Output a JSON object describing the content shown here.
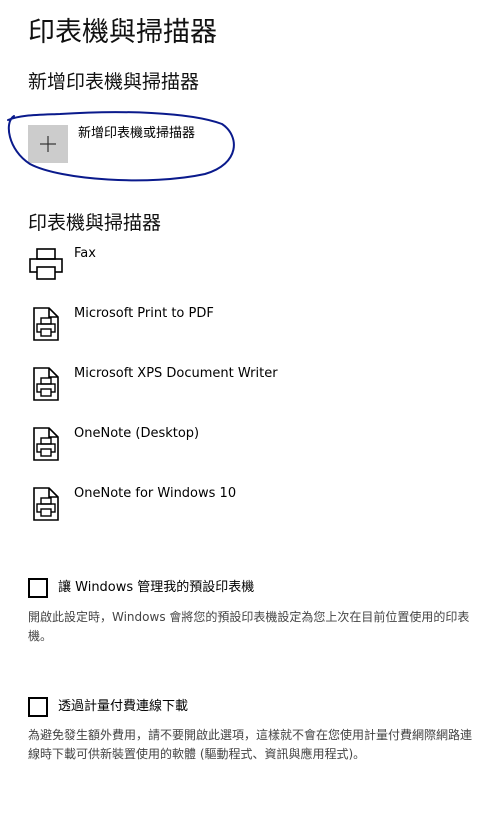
{
  "page": {
    "title": "印表機與掃描器"
  },
  "add_section": {
    "heading": "新增印表機與掃描器",
    "add_button_label": "新增印表機或掃描器",
    "add_icon": "plus-icon"
  },
  "printers_section": {
    "heading": "印表機與掃描器",
    "items": [
      {
        "name": "Fax",
        "icon": "fax-printer-icon"
      },
      {
        "name": "Microsoft Print to PDF",
        "icon": "printer-icon"
      },
      {
        "name": "Microsoft XPS Document Writer",
        "icon": "printer-icon"
      },
      {
        "name": "OneNote (Desktop)",
        "icon": "printer-icon"
      },
      {
        "name": "OneNote for Windows 10",
        "icon": "printer-icon"
      }
    ]
  },
  "options": [
    {
      "label": "讓 Windows 管理我的預設印表機",
      "checked": false,
      "description": "開啟此設定時，Windows 會將您的預設印表機設定為您上次在目前位置使用的印表機。"
    },
    {
      "label": "透過計量付費連線下載",
      "checked": false,
      "description": "為避免發生額外費用，請不要開啟此選項，這樣就不會在您使用計量付費網際網路連線時下載可供新裝置使用的軟體 (驅動程式、資訊與應用程式)。"
    }
  ],
  "colors": {
    "tile_bg": "#cccccc",
    "annotation_ink": "#0a1a8c",
    "description_text": "#444444"
  }
}
